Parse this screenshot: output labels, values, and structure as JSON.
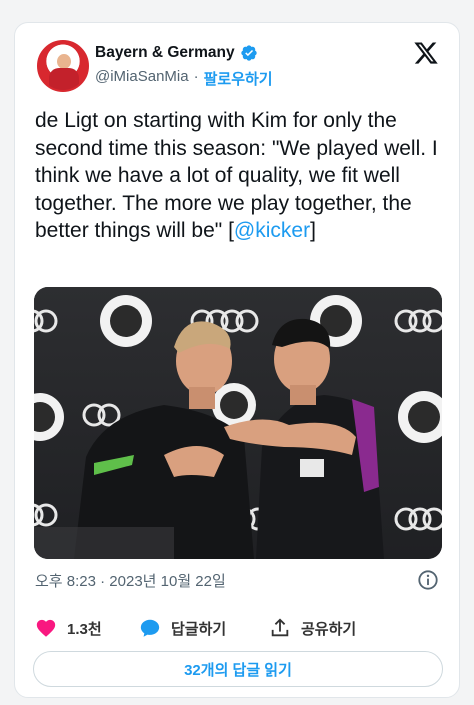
{
  "author": {
    "display_name": "Bayern & Germany",
    "handle": "@iMiaSanMia",
    "separator": "·",
    "follow_label": "팔로우하기"
  },
  "tweet": {
    "text_main": "de Ligt on starting with Kim for only the second time this season: \"We played well. I think we have a lot of quality, we fit well together. The more we play together, the better things will be\"",
    "source_open": "[",
    "source_mention": "@kicker",
    "source_close": "]",
    "timestamp": "오후 8:23 · 2023년 10월 22일"
  },
  "actions": {
    "likes_count": "1.3천",
    "reply_label": "답글하기",
    "share_label": "공유하기"
  },
  "read_replies_label": "32개의 답글 읽기",
  "photo": {
    "description_icons": [
      "audi-rings-icon",
      "fc-bayern-logo-icon"
    ]
  },
  "colors": {
    "accent": "#1d9bf0",
    "like": "#f91880",
    "text": "#0f1419",
    "muted": "#536471"
  }
}
